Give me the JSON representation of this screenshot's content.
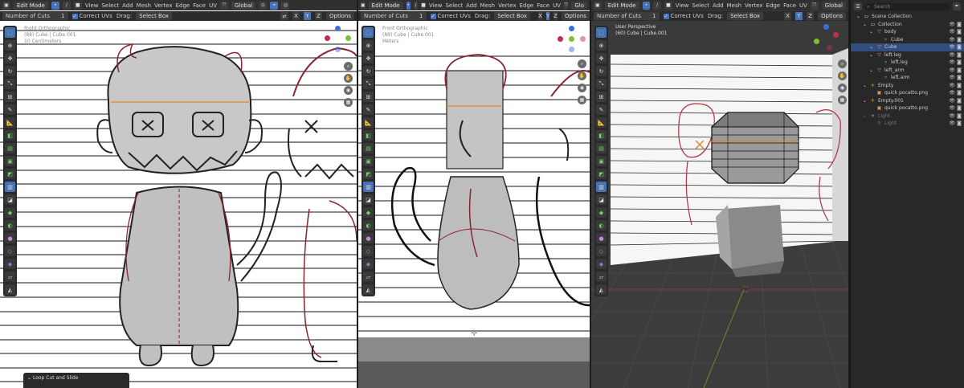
{
  "header": {
    "mode": "Edit Mode",
    "menus": [
      "View",
      "Select",
      "Add",
      "Mesh",
      "Vertex",
      "Edge",
      "Face",
      "UV"
    ],
    "orientation": "Global",
    "gizmo_label": "Glo"
  },
  "subheader": {
    "cuts_label": "Number of Cuts",
    "cuts_value": "1",
    "correct_uvs": "Correct UVs",
    "drag_label": "Drag:",
    "drag_value": "Select Box",
    "options": "Options"
  },
  "viewports": [
    {
      "title": "Right Orthographic",
      "object": "(88) Cube | Cube.001",
      "extra": "10 Centimeters"
    },
    {
      "title": "Front Orthographic",
      "object": "(88) Cube | Cube.001",
      "extra": "Meters"
    },
    {
      "title": "User Perspective",
      "object": "(60) Cube | Cube.001",
      "extra": ""
    }
  ],
  "axes": {
    "x": "X",
    "y": "Y",
    "z": "Z"
  },
  "operator_panel": {
    "title": "Loop Cut and Slide"
  },
  "outliner": {
    "search_placeholder": "Search",
    "rows": [
      {
        "label": "Scene Collection",
        "indent": 0,
        "icon": "collection",
        "selected": false,
        "dim": false
      },
      {
        "label": "Collection",
        "indent": 1,
        "icon": "collection",
        "selected": false,
        "dim": false
      },
      {
        "label": "body",
        "indent": 2,
        "icon": "mesh",
        "selected": false,
        "dim": false
      },
      {
        "label": "Cube",
        "indent": 3,
        "icon": "mesh-data",
        "selected": false,
        "dim": false
      },
      {
        "label": "Cube",
        "indent": 2,
        "icon": "mesh",
        "selected": true,
        "dim": false
      },
      {
        "label": "left.leg",
        "indent": 2,
        "icon": "mesh",
        "selected": false,
        "dim": false
      },
      {
        "label": "left.leg",
        "indent": 3,
        "icon": "mesh-data",
        "selected": false,
        "dim": false
      },
      {
        "label": "left_arm",
        "indent": 2,
        "icon": "mesh",
        "selected": false,
        "dim": false
      },
      {
        "label": "left.arm",
        "indent": 3,
        "icon": "mesh-data",
        "selected": false,
        "dim": false
      },
      {
        "label": "Empty",
        "indent": 1,
        "icon": "empty",
        "selected": false,
        "dim": false
      },
      {
        "label": "quick pocatto.png",
        "indent": 2,
        "icon": "image",
        "selected": false,
        "dim": false
      },
      {
        "label": "Empty.001",
        "indent": 1,
        "icon": "empty",
        "selected": false,
        "dim": false
      },
      {
        "label": "quick pocatto.png",
        "indent": 2,
        "icon": "image",
        "selected": false,
        "dim": false
      },
      {
        "label": "Light",
        "indent": 1,
        "icon": "light",
        "selected": false,
        "dim": true
      },
      {
        "label": "Light",
        "indent": 2,
        "icon": "light-data",
        "selected": false,
        "dim": true
      }
    ]
  },
  "colors": {
    "accent": "#4772b3",
    "selected_row": "#334d80",
    "header_bg": "#303030",
    "outline_red": "#b03040",
    "edge_orange": "#e08a2c"
  }
}
